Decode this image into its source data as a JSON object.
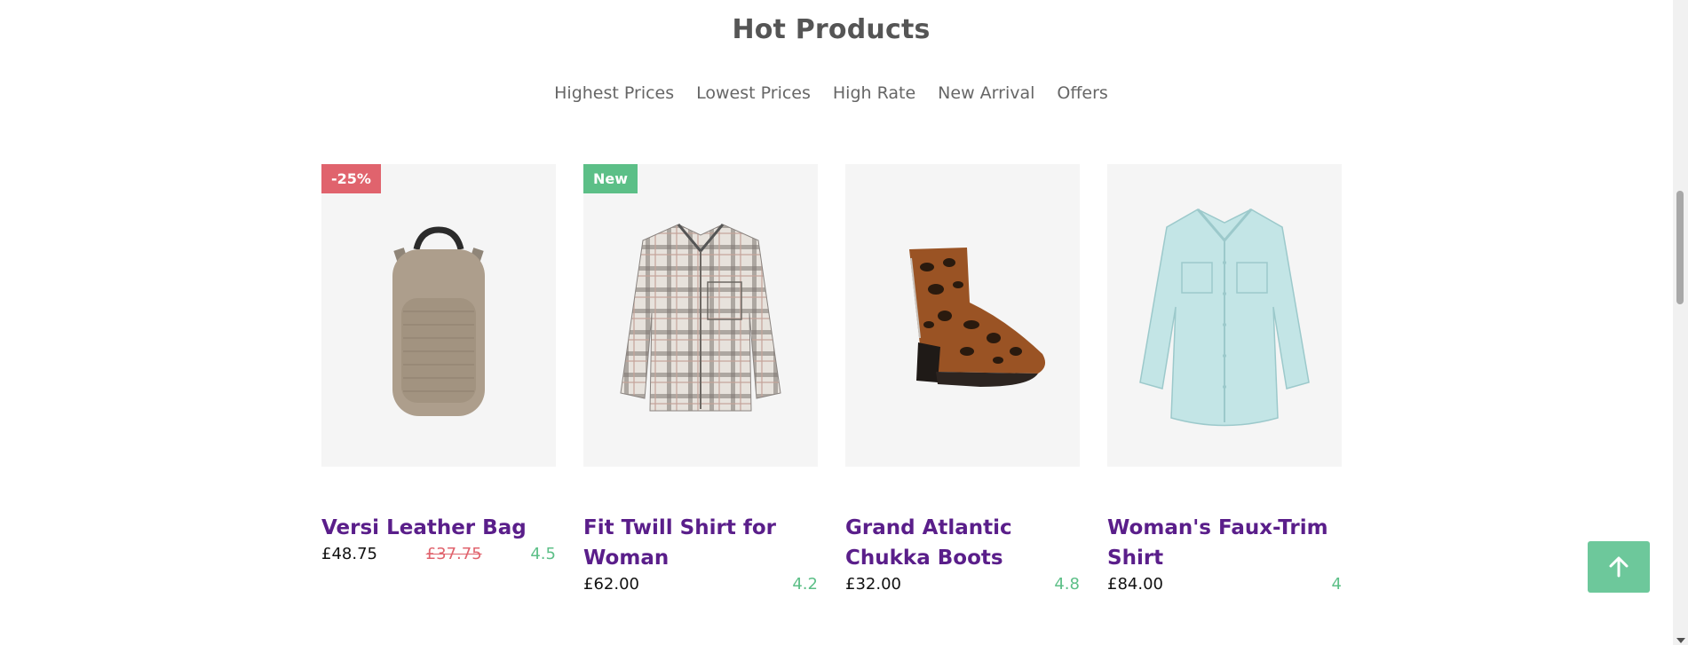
{
  "section": {
    "title": "Hot Products"
  },
  "filters": [
    "Highest Prices",
    "Lowest Prices",
    "High Rate",
    "New Arrival",
    "Offers"
  ],
  "products": [
    {
      "badge": "-25%",
      "badge_type": "sale",
      "title": "Versi Leather Bag",
      "price": "£48.75",
      "old_price": "£37.75",
      "rating": "4.5",
      "image_icon": "backpack-icon"
    },
    {
      "badge": "New",
      "badge_type": "new",
      "title": "Fit Twill Shirt for Woman",
      "price": "£62.00",
      "old_price": "",
      "rating": "4.2",
      "image_icon": "plaid-shirt-icon"
    },
    {
      "badge": "",
      "badge_type": "",
      "title": "Grand Atlantic Chukka Boots",
      "price": "£32.00",
      "old_price": "",
      "rating": "4.8",
      "image_icon": "leopard-boot-icon"
    },
    {
      "badge": "",
      "badge_type": "",
      "title": "Woman's Faux-Trim Shirt",
      "price": "£84.00",
      "old_price": "",
      "rating": "4",
      "image_icon": "blue-shirt-icon"
    }
  ],
  "colors": {
    "title": "#555555",
    "product_title": "#5a1e8a",
    "sale": "#e0636d",
    "new": "#5cbf87",
    "rating": "#5cbf87",
    "back_to_top": "#6dc89b"
  },
  "back_to_top": {
    "icon": "arrow-up-icon"
  }
}
